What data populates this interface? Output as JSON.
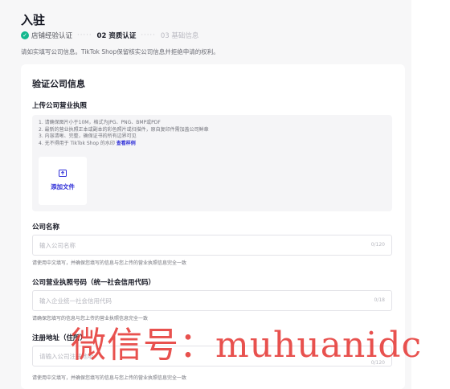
{
  "header": {
    "title": "入驻"
  },
  "steps": [
    {
      "label": "店铺经验认证",
      "state": "done"
    },
    {
      "label": "02 资质认证",
      "state": "current"
    },
    {
      "label": "03 基础信息",
      "state": "pending"
    }
  ],
  "step_separator": "·····",
  "intro_text": "请如实填写公司信息。TikTok Shop保留核实公司信息并拒绝申请的权利。",
  "card": {
    "title": "验证公司信息",
    "license_section_title": "上传公司营业执照",
    "rules": [
      "1. 请确保图片小于10M，格式为JPG、PNG、BMP或PDF",
      "2. 最新的营业执照正本或副本的彩色照片或扫描件，原自复印件需加盖公司鲜章",
      "3. 内容清晰、完整，确保证书的所有边界可见",
      "4. 无不得用于 TikTok Shop 的水印"
    ],
    "rules_link": "查看样例",
    "upload_label": "添加文件",
    "upload_icon": "upload-file-icon"
  },
  "fields": [
    {
      "label": "公司名称",
      "placeholder": "输入公司名称",
      "counter": "0/120",
      "helper": "请使用中文填写，并确保您填写的信息与您上传的营业执照信息完全一致"
    },
    {
      "label": "公司营业执照号码（统一社会信用代码）",
      "placeholder": "输入企业统一社会信用代码",
      "counter": "0/18",
      "helper": "请确保您填写的信息与您上传的营业执照信息完全一致"
    },
    {
      "label": "注册地址（住所）",
      "placeholder": "请输入公司注册地址",
      "counter": "0/120",
      "helper": "请使用中文填写，并确保您填写的信息与您上传的营业执照信息完全一致"
    }
  ],
  "watermark": "微信号：muhuanidc",
  "colors": {
    "accent": "#2f2fd8",
    "success": "#13b88e",
    "watermark": "#e53935"
  }
}
